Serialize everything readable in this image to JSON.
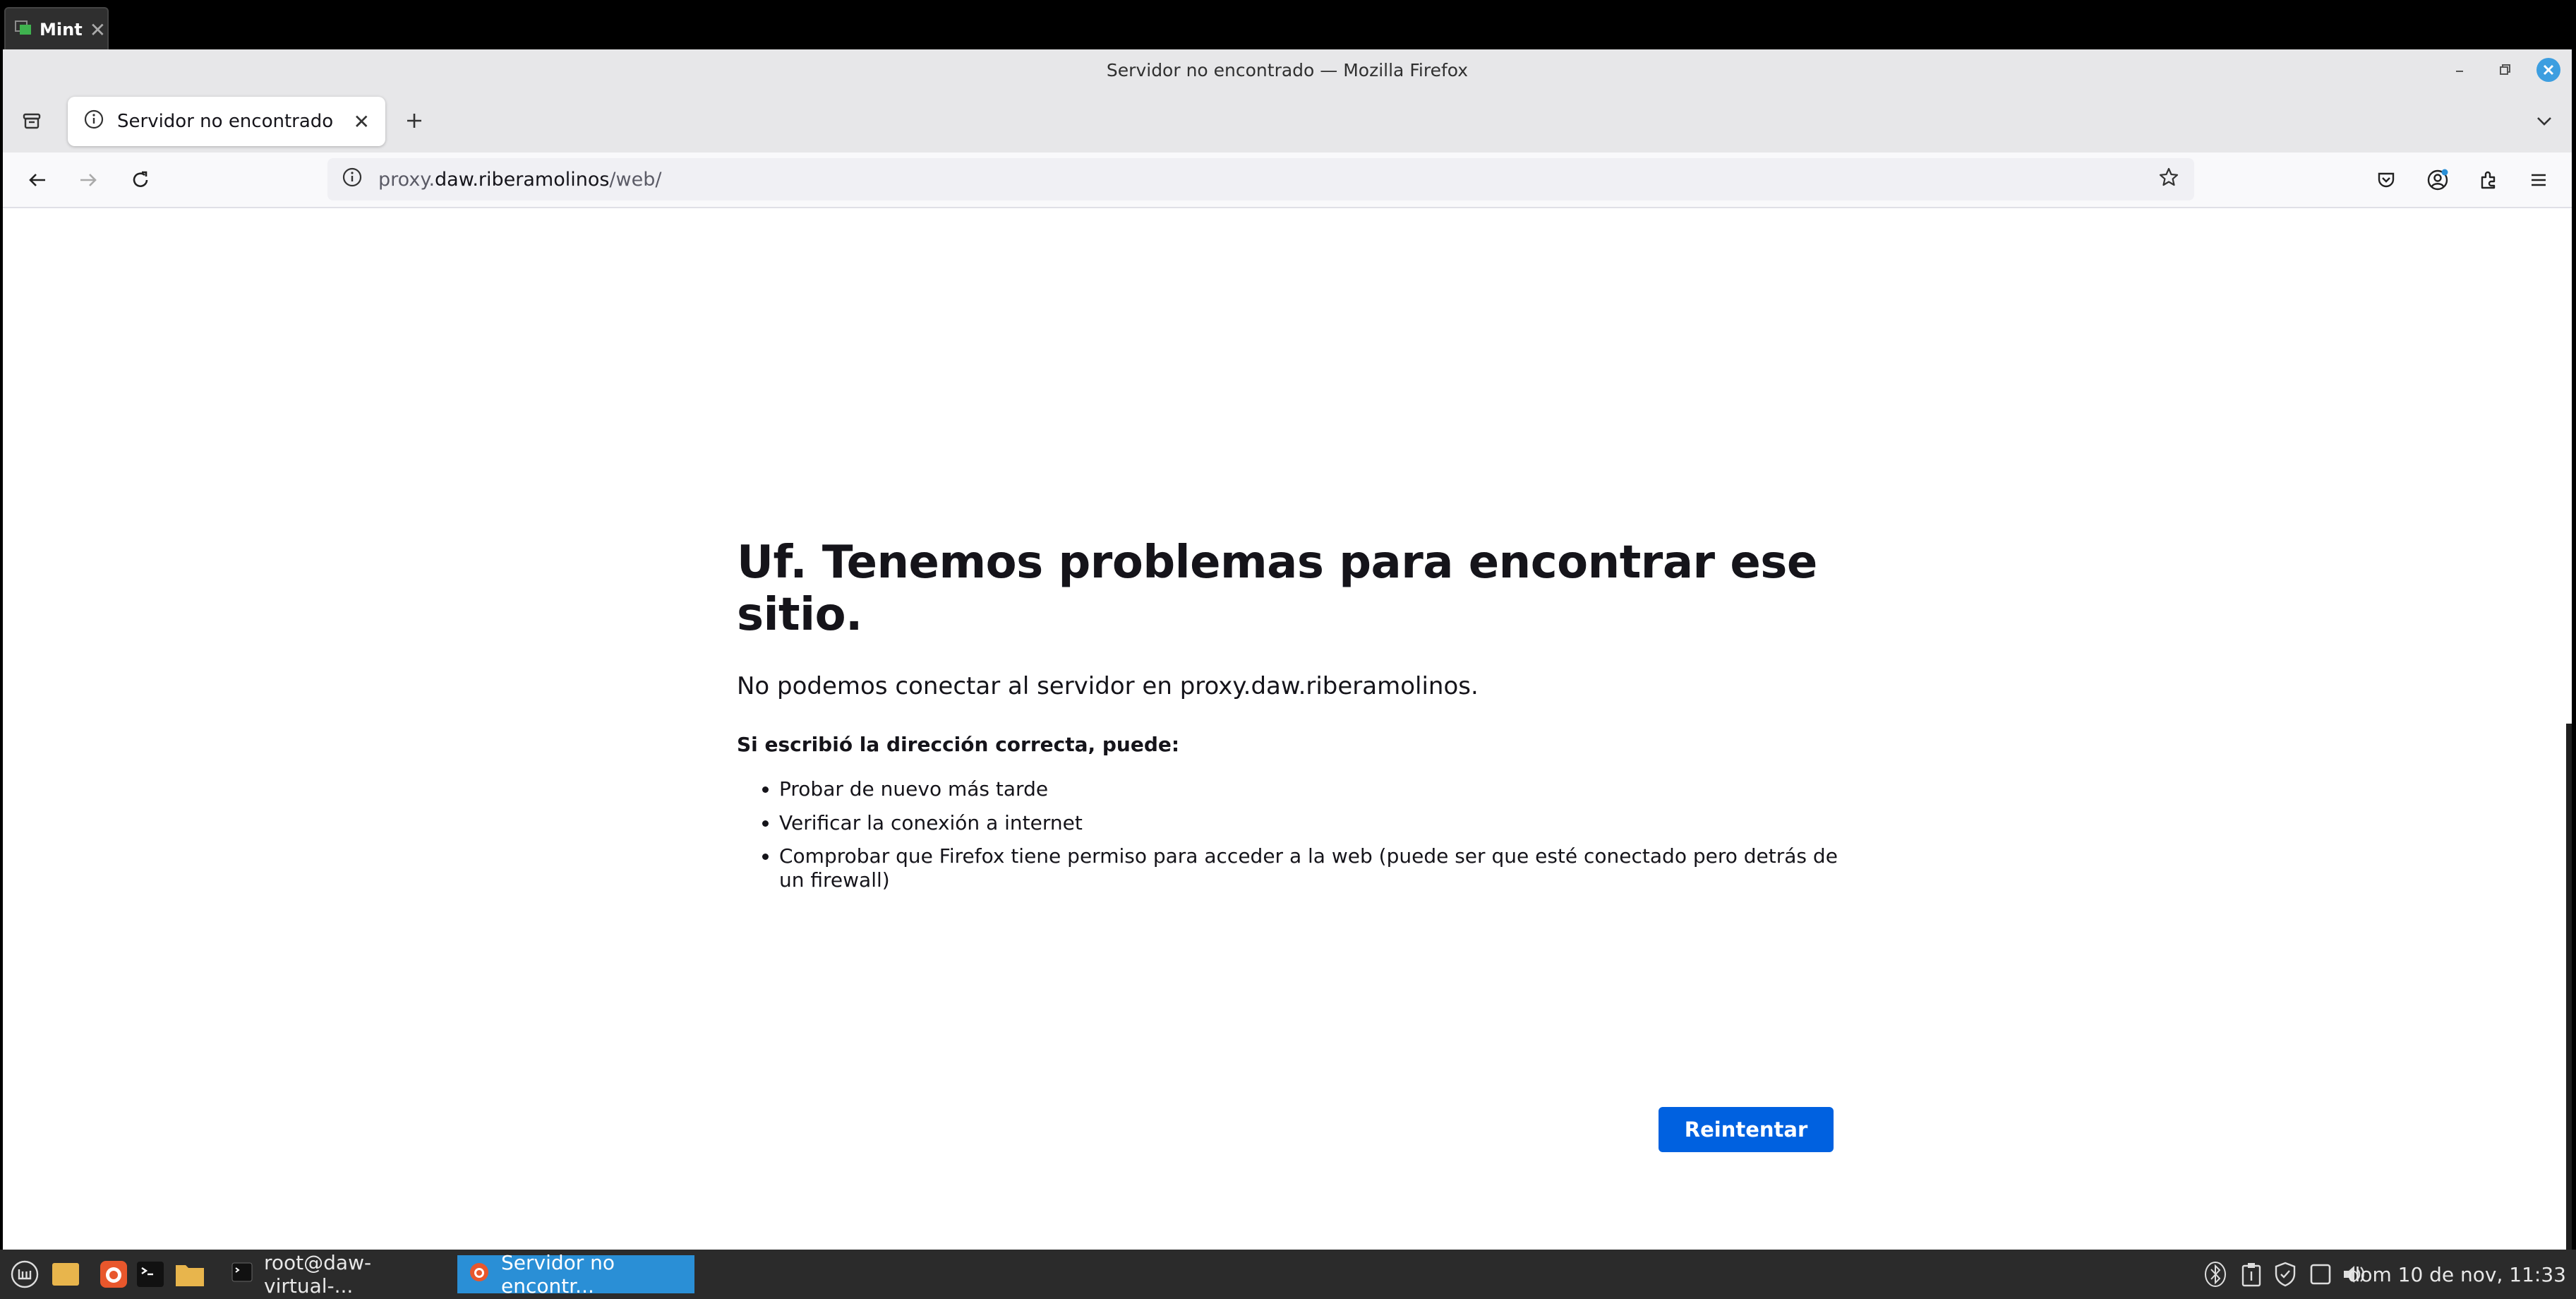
{
  "vm": {
    "tab_label": "Mint",
    "tab_close": "✕"
  },
  "window": {
    "title": "Servidor no encontrado — Mozilla Firefox"
  },
  "tabs": [
    {
      "label": "Servidor no encontrado",
      "close": "✕"
    }
  ],
  "url": {
    "prefix": "proxy.",
    "host": "daw.riberamolinos",
    "path": "/web/"
  },
  "error": {
    "title": "Uf. Tenemos problemas para encontrar ese sitio.",
    "intro": "No podemos conectar al servidor en proxy.daw.riberamolinos.",
    "subtitle": "Si escribió la dirección correcta, puede:",
    "items": [
      "Probar de nuevo más tarde",
      "Verificar la conexión a internet",
      "Comprobar que Firefox tiene permiso para acceder a la web (puede ser que esté conectado pero detrás de un firewall)"
    ],
    "retry_label": "Reintentar"
  },
  "taskbar": {
    "tasks": [
      {
        "label": "root@daw-virtual-..."
      },
      {
        "label": "Servidor no encontr..."
      }
    ],
    "clock": "dom 10 de nov, 11:33"
  },
  "colors": {
    "accent": "#0061e0",
    "taskbar": "#2b2b2b",
    "active_task": "#2a8fd6",
    "titlebar": "#e7e7e9"
  }
}
